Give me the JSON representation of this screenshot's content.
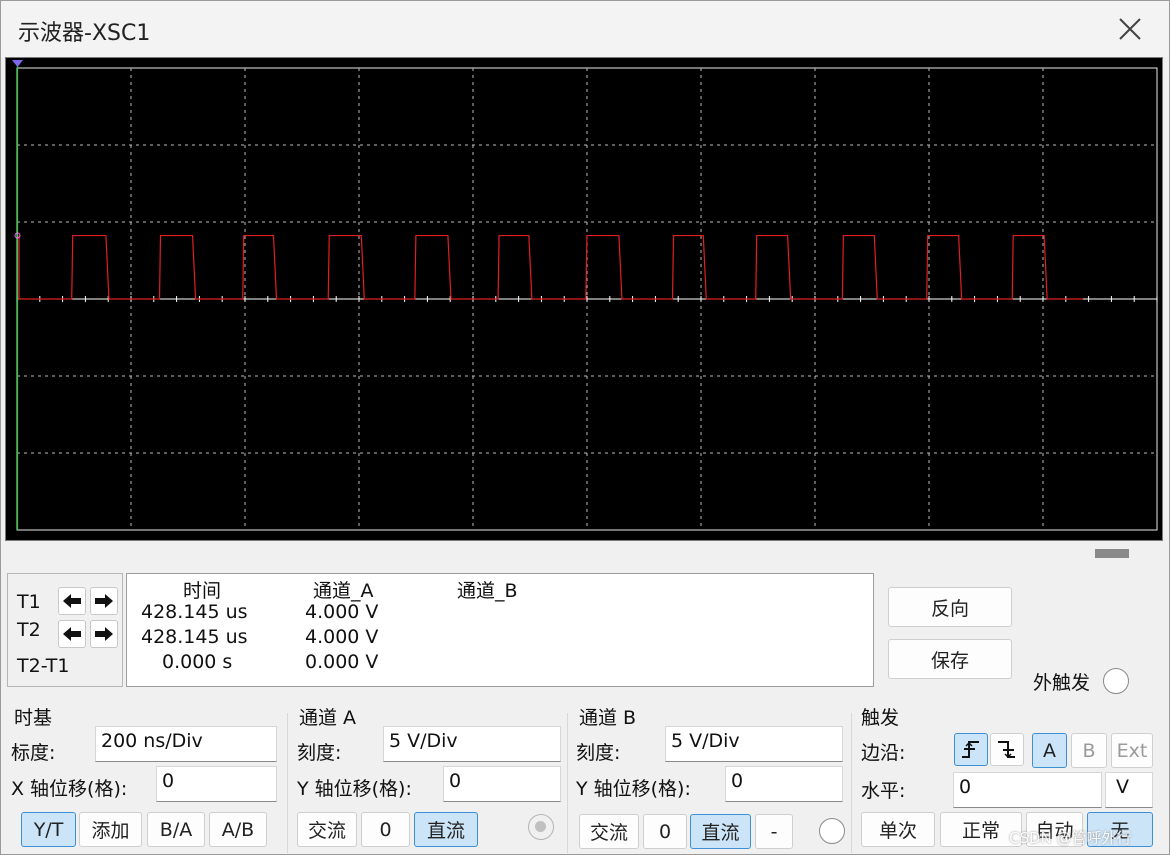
{
  "window": {
    "title": "示波器-XSC1"
  },
  "cursors": {
    "t1_label": "T1",
    "t2_label": "T2",
    "diff_label": "T2-T1"
  },
  "readout": {
    "headers": {
      "time": "时间",
      "channel_a": "通道_A",
      "channel_b": "通道_B"
    },
    "rows": [
      {
        "time": "428.145 us",
        "channel_a": "4.000 V",
        "channel_b": ""
      },
      {
        "time": "428.145 us",
        "channel_a": "4.000 V",
        "channel_b": ""
      },
      {
        "time": "0.000 s",
        "channel_a": "0.000 V",
        "channel_b": ""
      }
    ]
  },
  "actions": {
    "reverse": "反向",
    "save": "保存",
    "ext_trigger": "外触发"
  },
  "timebase": {
    "title": "时基",
    "scale_label": "标度:",
    "scale_value": "200 ns/Div",
    "x_offset_label": "X 轴位移(格):",
    "x_offset_value": "0",
    "modes": [
      "Y/T",
      "添加",
      "B/A",
      "A/B"
    ],
    "selected_mode": "Y/T"
  },
  "channel_a": {
    "title": "通道 A",
    "scale_label": "刻度:",
    "scale_value": "5  V/Div",
    "y_offset_label": "Y 轴位移(格):",
    "y_offset_value": "0",
    "coupling": [
      "交流",
      "0",
      "直流"
    ],
    "selected_coupling": "直流"
  },
  "channel_b": {
    "title": "通道 B",
    "scale_label": "刻度:",
    "scale_value": "5  V/Div",
    "y_offset_label": "Y 轴位移(格):",
    "y_offset_value": "0",
    "coupling": [
      "交流",
      "0",
      "直流",
      "-"
    ],
    "selected_coupling": "直流"
  },
  "trigger": {
    "title": "触发",
    "edge_label": "边沿:",
    "sources": [
      "A",
      "B",
      "Ext"
    ],
    "selected_source": "A",
    "level_label": "水平:",
    "level_value": "0",
    "level_unit": "V",
    "modes": [
      "单次",
      "正常",
      "自动",
      "无"
    ],
    "selected_mode": "无"
  },
  "watermark": "CSDN @管呼外行",
  "chart_data": {
    "type": "line",
    "title": "",
    "xlabel": "",
    "ylabel": "",
    "grid": true,
    "divisions_x": 10,
    "divisions_y": 6,
    "volts_per_div": 5,
    "series": [
      {
        "color": "#e02020",
        "waveform": "square",
        "low_v": 0,
        "high_v": 4,
        "pulses_x_div": [
          [
            0.48,
            0.78
          ],
          [
            1.25,
            1.54
          ],
          [
            1.98,
            2.25
          ],
          [
            2.73,
            3.02
          ],
          [
            3.49,
            3.78
          ],
          [
            4.22,
            4.49
          ],
          [
            4.99,
            5.28
          ],
          [
            5.75,
            6.02
          ],
          [
            6.48,
            6.76
          ],
          [
            7.24,
            7.52
          ],
          [
            7.98,
            8.26
          ],
          [
            8.73,
            9.01
          ]
        ],
        "end_x_div": 9.35
      }
    ]
  }
}
